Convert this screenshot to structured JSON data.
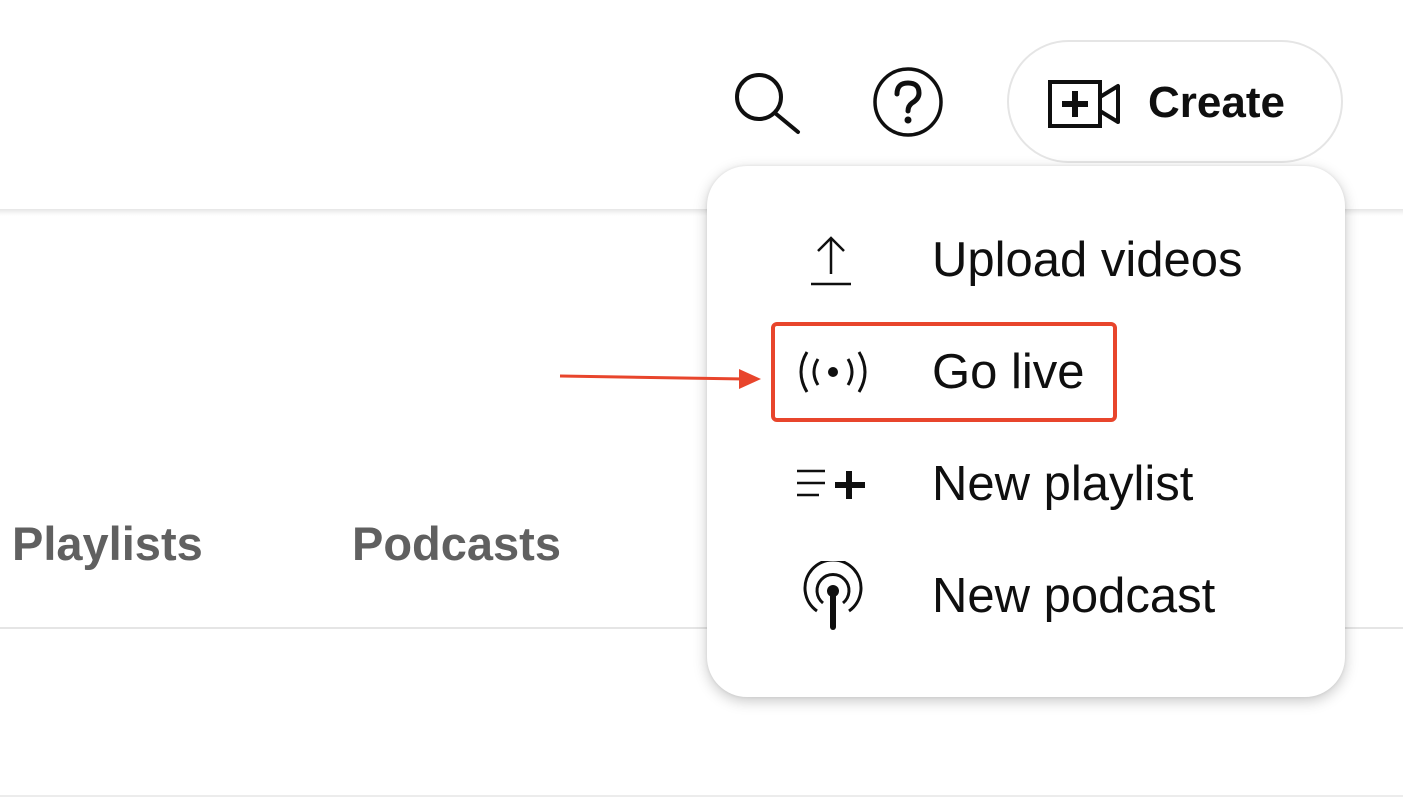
{
  "header": {
    "search_icon": "search-icon",
    "help_icon": "help-icon",
    "create_button": {
      "label": "Create",
      "icon": "video-plus-icon"
    }
  },
  "tabs": [
    {
      "label": "Playlists"
    },
    {
      "label": "Podcasts"
    }
  ],
  "create_menu": {
    "items": [
      {
        "label": "Upload videos",
        "icon": "upload-icon"
      },
      {
        "label": "Go live",
        "icon": "broadcast-icon",
        "highlighted": true
      },
      {
        "label": "New playlist",
        "icon": "playlist-add-icon"
      },
      {
        "label": "New podcast",
        "icon": "podcast-icon"
      }
    ]
  },
  "annotation": {
    "highlight_color": "#e8452c",
    "target": "Go live"
  },
  "colors": {
    "text_primary": "#0f0f0f",
    "text_secondary": "#606060",
    "border": "#e5e5e5"
  }
}
